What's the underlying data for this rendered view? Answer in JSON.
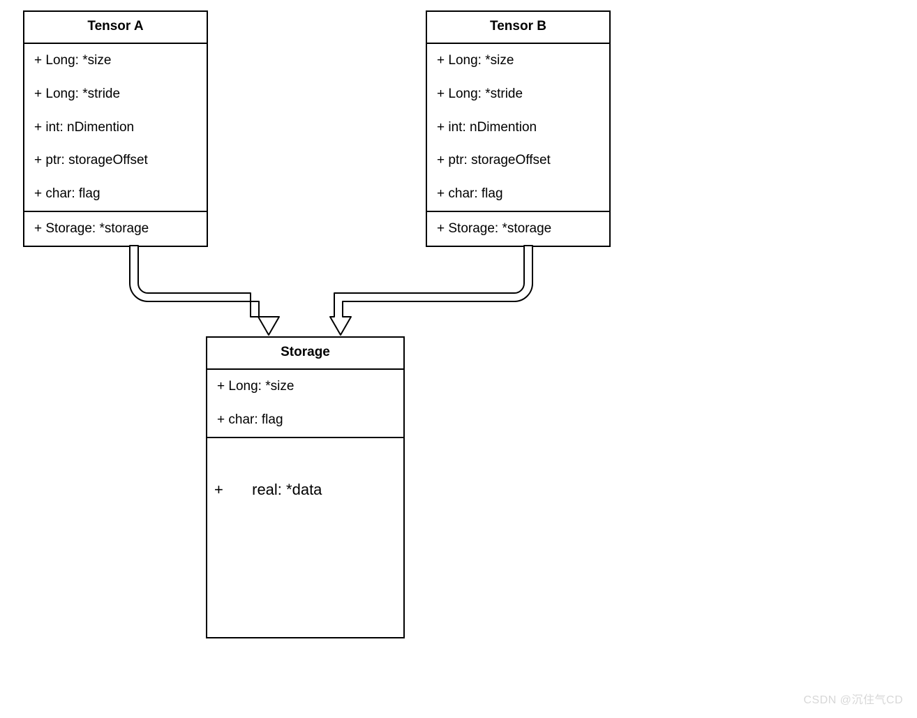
{
  "tensorA": {
    "title": "Tensor A",
    "attrs": [
      "+ Long: *size",
      "+ Long: *stride",
      "+ int:  nDimention",
      "+ ptr: storageOffset",
      "+ char: flag"
    ],
    "refs": [
      "+ Storage: *storage"
    ]
  },
  "tensorB": {
    "title": "Tensor B",
    "attrs": [
      "+ Long: *size",
      "+ Long: *stride",
      "+ int:  nDimention",
      "+ ptr: storageOffset",
      "+ char: flag"
    ],
    "refs": [
      "+ Storage: *storage"
    ]
  },
  "storage": {
    "title": "Storage",
    "attrs": [
      "+ Long: *size",
      "+ char: flag"
    ],
    "dataPlus": "+",
    "dataLabel": "real: *data"
  },
  "watermark": "CSDN @沉住气CD"
}
